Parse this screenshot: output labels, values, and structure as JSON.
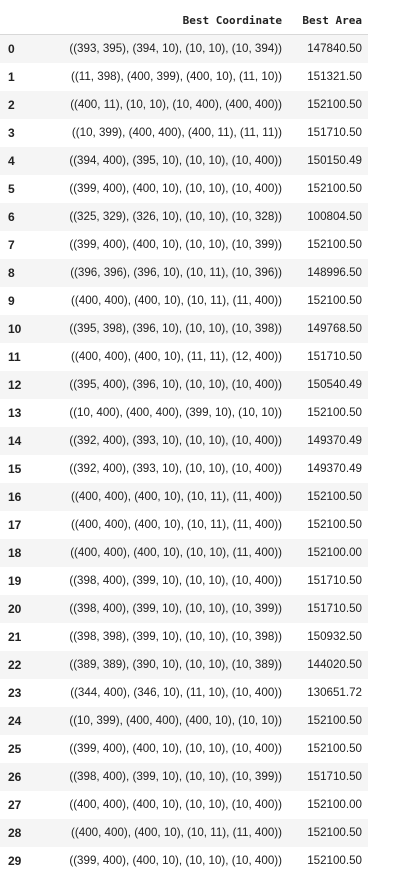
{
  "dataframe": {
    "columns": [
      "Best Coordinate",
      "Best Area"
    ],
    "rows": [
      {
        "index": "0",
        "coordinate": "((393, 395), (394, 10), (10, 10), (10, 394))",
        "area": "147840.50"
      },
      {
        "index": "1",
        "coordinate": "((11, 398), (400, 399), (400, 10), (11, 10))",
        "area": "151321.50"
      },
      {
        "index": "2",
        "coordinate": "((400, 11), (10, 10), (10, 400), (400, 400))",
        "area": "152100.50"
      },
      {
        "index": "3",
        "coordinate": "((10, 399), (400, 400), (400, 11), (11, 11))",
        "area": "151710.50"
      },
      {
        "index": "4",
        "coordinate": "((394, 400), (395, 10), (10, 10), (10, 400))",
        "area": "150150.49"
      },
      {
        "index": "5",
        "coordinate": "((399, 400), (400, 10), (10, 10), (10, 400))",
        "area": "152100.50"
      },
      {
        "index": "6",
        "coordinate": "((325, 329), (326, 10), (10, 10), (10, 328))",
        "area": "100804.50"
      },
      {
        "index": "7",
        "coordinate": "((399, 400), (400, 10), (10, 10), (10, 399))",
        "area": "152100.50"
      },
      {
        "index": "8",
        "coordinate": "((396, 396), (396, 10), (10, 11), (10, 396))",
        "area": "148996.50"
      },
      {
        "index": "9",
        "coordinate": "((400, 400), (400, 10), (10, 11), (11, 400))",
        "area": "152100.50"
      },
      {
        "index": "10",
        "coordinate": "((395, 398), (396, 10), (10, 10), (10, 398))",
        "area": "149768.50"
      },
      {
        "index": "11",
        "coordinate": "((400, 400), (400, 10), (11, 11), (12, 400))",
        "area": "151710.50"
      },
      {
        "index": "12",
        "coordinate": "((395, 400), (396, 10), (10, 10), (10, 400))",
        "area": "150540.49"
      },
      {
        "index": "13",
        "coordinate": "((10, 400), (400, 400), (399, 10), (10, 10))",
        "area": "152100.50"
      },
      {
        "index": "14",
        "coordinate": "((392, 400), (393, 10), (10, 10), (10, 400))",
        "area": "149370.49"
      },
      {
        "index": "15",
        "coordinate": "((392, 400), (393, 10), (10, 10), (10, 400))",
        "area": "149370.49"
      },
      {
        "index": "16",
        "coordinate": "((400, 400), (400, 10), (10, 11), (11, 400))",
        "area": "152100.50"
      },
      {
        "index": "17",
        "coordinate": "((400, 400), (400, 10), (10, 11), (11, 400))",
        "area": "152100.50"
      },
      {
        "index": "18",
        "coordinate": "((400, 400), (400, 10), (10, 10), (11, 400))",
        "area": "152100.00"
      },
      {
        "index": "19",
        "coordinate": "((398, 400), (399, 10), (10, 10), (10, 400))",
        "area": "151710.50"
      },
      {
        "index": "20",
        "coordinate": "((398, 400), (399, 10), (10, 10), (10, 399))",
        "area": "151710.50"
      },
      {
        "index": "21",
        "coordinate": "((398, 398), (399, 10), (10, 10), (10, 398))",
        "area": "150932.50"
      },
      {
        "index": "22",
        "coordinate": "((389, 389), (390, 10), (10, 10), (10, 389))",
        "area": "144020.50"
      },
      {
        "index": "23",
        "coordinate": "((344, 400), (346, 10), (11, 10), (10, 400))",
        "area": "130651.72"
      },
      {
        "index": "24",
        "coordinate": "((10, 399), (400, 400), (400, 10), (10, 10))",
        "area": "152100.50"
      },
      {
        "index": "25",
        "coordinate": "((399, 400), (400, 10), (10, 10), (10, 400))",
        "area": "152100.50"
      },
      {
        "index": "26",
        "coordinate": "((398, 400), (399, 10), (10, 10), (10, 399))",
        "area": "151710.50"
      },
      {
        "index": "27",
        "coordinate": "((400, 400), (400, 10), (10, 10), (10, 400))",
        "area": "152100.00"
      },
      {
        "index": "28",
        "coordinate": "((400, 400), (400, 10), (10, 11), (11, 400))",
        "area": "152100.50"
      },
      {
        "index": "29",
        "coordinate": "((399, 400), (400, 10), (10, 10), (10, 400))",
        "area": "152100.50"
      }
    ]
  }
}
